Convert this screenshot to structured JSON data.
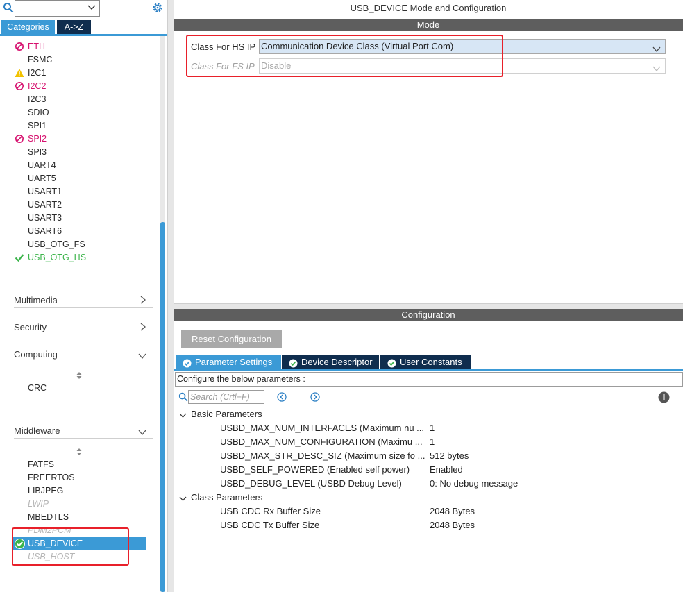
{
  "sidebar": {
    "tabs": {
      "categories": "Categories",
      "az": "A->Z"
    },
    "peripherals": [
      {
        "label": "ETH",
        "status": "blocked"
      },
      {
        "label": "FSMC",
        "status": "none"
      },
      {
        "label": "I2C1",
        "status": "warning"
      },
      {
        "label": "I2C2",
        "status": "blocked"
      },
      {
        "label": "I2C3",
        "status": "none"
      },
      {
        "label": "SDIO",
        "status": "none"
      },
      {
        "label": "SPI1",
        "status": "none"
      },
      {
        "label": "SPI2",
        "status": "blocked"
      },
      {
        "label": "SPI3",
        "status": "none"
      },
      {
        "label": "UART4",
        "status": "none"
      },
      {
        "label": "UART5",
        "status": "none"
      },
      {
        "label": "USART1",
        "status": "none"
      },
      {
        "label": "USART2",
        "status": "none"
      },
      {
        "label": "USART3",
        "status": "none"
      },
      {
        "label": "USART6",
        "status": "none"
      },
      {
        "label": "USB_OTG_FS",
        "status": "none"
      },
      {
        "label": "USB_OTG_HS",
        "status": "ok"
      }
    ],
    "categories": {
      "multimedia": "Multimedia",
      "security": "Security",
      "computing": "Computing",
      "middleware": "Middleware"
    },
    "computing_items": [
      "CRC"
    ],
    "middleware_items": [
      {
        "label": "FATFS",
        "status": "none"
      },
      {
        "label": "FREERTOS",
        "status": "none"
      },
      {
        "label": "LIBJPEG",
        "status": "none"
      },
      {
        "label": "LWIP",
        "status": "disabled"
      },
      {
        "label": "MBEDTLS",
        "status": "none"
      },
      {
        "label": "PDM2PCM",
        "status": "disabled"
      },
      {
        "label": "USB_DEVICE",
        "status": "selected"
      },
      {
        "label": "USB_HOST",
        "status": "disabled"
      }
    ]
  },
  "main": {
    "title": "USB_DEVICE Mode and Configuration",
    "mode_header": "Mode",
    "hs_label": "Class For HS IP",
    "hs_value": "Communication Device Class (Virtual Port Com)",
    "fs_label": "Class For FS IP",
    "fs_value": "Disable",
    "config_header": "Configuration",
    "reset_label": "Reset Configuration",
    "tabs": [
      "Parameter Settings",
      "Device Descriptor",
      "User Constants"
    ],
    "configure_text": "Configure the below parameters :",
    "search_placeholder": "Search (Crtl+F)",
    "groups": [
      {
        "name": "Basic Parameters",
        "params": [
          {
            "name": "USBD_MAX_NUM_INTERFACES (Maximum number of supported interfaces)",
            "value": "1"
          },
          {
            "name": "USBD_MAX_NUM_CONFIGURATION (Maximum number of supported configuration)",
            "value": "1"
          },
          {
            "name": "USBD_MAX_STR_DESC_SIZ (Maximum size for the string descriptors)",
            "value": "512 bytes"
          },
          {
            "name": "USBD_SELF_POWERED (Enabled self power)",
            "value": "Enabled"
          },
          {
            "name": "USBD_DEBUG_LEVEL (USBD Debug Level)",
            "value": "0: No debug message"
          }
        ]
      },
      {
        "name": "Class Parameters",
        "params": [
          {
            "name": "USB CDC Rx Buffer Size",
            "value": "2048 Bytes"
          },
          {
            "name": "USB CDC Tx Buffer Size",
            "value": "2048 Bytes"
          }
        ]
      }
    ]
  },
  "colors": {
    "accent": "#3b9ad6",
    "dark_tab": "#0f2d4e",
    "blocked": "#d6106e",
    "ok": "#3cb44b",
    "warning": "#f2c200",
    "highlight": "#e8202a"
  }
}
